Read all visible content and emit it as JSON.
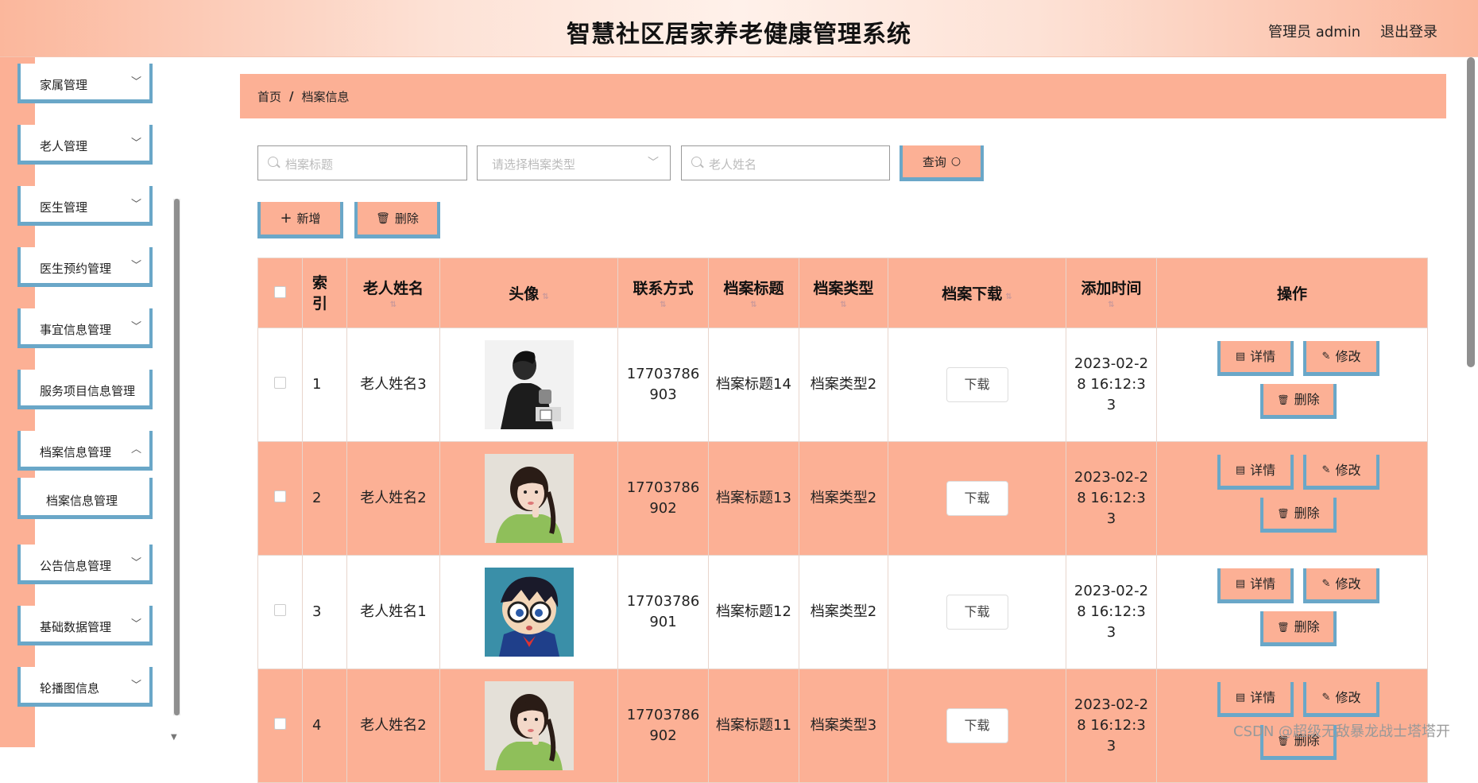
{
  "header": {
    "title": "智慧社区居家养老健康管理系统",
    "user": "管理员 admin",
    "logout": "退出登录"
  },
  "sidebar": {
    "items": [
      {
        "label": "家属管理"
      },
      {
        "label": "老人管理"
      },
      {
        "label": "医生管理"
      },
      {
        "label": "医生预约管理"
      },
      {
        "label": "事宜信息管理"
      },
      {
        "label": "服务项目信息管理"
      },
      {
        "label": "档案信息管理"
      },
      {
        "label": "公告信息管理"
      },
      {
        "label": "基础数据管理"
      },
      {
        "label": "轮播图信息"
      }
    ],
    "sub_item": "档案信息管理"
  },
  "breadcrumb": {
    "home": "首页",
    "separator": "/",
    "current": "档案信息"
  },
  "search": {
    "title_placeholder": "档案标题",
    "type_placeholder": "请选择档案类型",
    "name_placeholder": "老人姓名",
    "query_label": "查询"
  },
  "toolbar": {
    "add_label": "新增",
    "delete_label": "删除"
  },
  "table": {
    "columns": [
      "索引",
      "老人姓名",
      "头像",
      "联系方式",
      "档案标题",
      "档案类型",
      "档案下载",
      "添加时间",
      "操作"
    ],
    "rows": [
      {
        "index": "1",
        "name": "老人姓名3",
        "avatar": "man-silhouette",
        "phone": "17703786903",
        "title": "档案标题14",
        "type": "档案类型2",
        "download": "下载",
        "time": "2023-02-28 16:12:33"
      },
      {
        "index": "2",
        "name": "老人姓名2",
        "avatar": "girl-green-sweater",
        "phone": "17703786902",
        "title": "档案标题13",
        "type": "档案类型2",
        "download": "下载",
        "time": "2023-02-28 16:12:33"
      },
      {
        "index": "3",
        "name": "老人姓名1",
        "avatar": "cartoon-boy-glasses",
        "phone": "17703786901",
        "title": "档案标题12",
        "type": "档案类型2",
        "download": "下载",
        "time": "2023-02-28 16:12:33"
      },
      {
        "index": "4",
        "name": "老人姓名2",
        "avatar": "girl-green-sweater",
        "phone": "17703786902",
        "title": "档案标题11",
        "type": "档案类型3",
        "download": "下载",
        "time": "2023-02-28 16:12:33"
      }
    ],
    "actions": {
      "detail": "详情",
      "edit": "修改",
      "delete": "删除"
    }
  },
  "watermark": "CSDN @超级无敌暴龙战士塔塔开",
  "colors": {
    "accent": "#fcb095",
    "border_accent": "#6aa7c8"
  }
}
